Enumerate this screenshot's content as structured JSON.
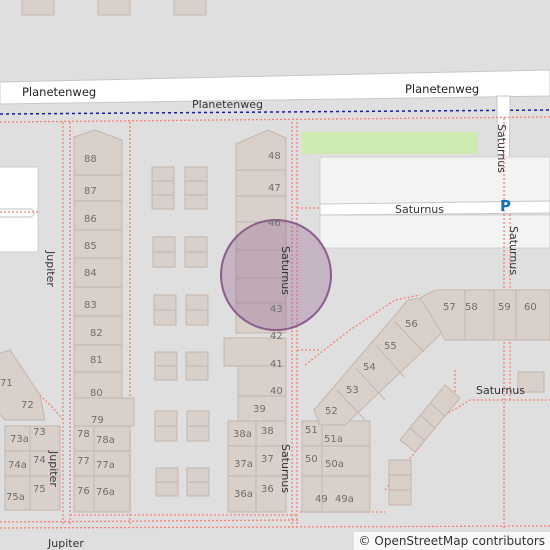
{
  "streets": {
    "planetenweg_left": "Planetenweg",
    "planetenweg_right": "Planetenweg",
    "planetenweg_path": "Planetenweg",
    "saturnus_vert_top": "Saturnus",
    "saturnus_horiz": "Saturnus",
    "saturnus_vert_right": "Saturnus",
    "saturnus_center": "Saturnus",
    "saturnus_bottom": "Saturnus",
    "saturnus_southeast": "Saturnus",
    "jupiter_left": "Jupiter",
    "jupiter_lower": "Jupiter",
    "jupiter_bottom": "Jupiter"
  },
  "parking_symbol": "P",
  "house_numbers": {
    "h88": "88",
    "h87": "87",
    "h86": "86",
    "h85": "85",
    "h84": "84",
    "h83": "83",
    "h82": "82",
    "h81": "81",
    "h80": "80",
    "h79": "79",
    "h78": "78",
    "h78a": "78a",
    "h77": "77",
    "h77a": "77a",
    "h76": "76",
    "h76a": "76a",
    "h73a": "73a",
    "h73": "73",
    "h74a": "74a",
    "h74": "74",
    "h75a": "75a",
    "h75": "75",
    "h72": "72",
    "h71": "71",
    "h48": "48",
    "h47": "47",
    "h46": "46",
    "h43": "43",
    "h42": "42",
    "h41": "41",
    "h40": "40",
    "h39": "39",
    "h38a": "38a",
    "h38": "38",
    "h37a": "37a",
    "h37": "37",
    "h36a": "36a",
    "h36": "36",
    "h51": "51",
    "h51a": "51a",
    "h50": "50",
    "h50a": "50a",
    "h49": "49",
    "h49a": "49a",
    "h52": "52",
    "h53": "53",
    "h54": "54",
    "h55": "55",
    "h56": "56",
    "h57": "57",
    "h58": "58",
    "h59": "59",
    "h60": "60"
  },
  "attribution": {
    "symbol": "©",
    "link": "OpenStreetMap contributors"
  },
  "colors": {
    "background": "#e0dfdf",
    "road": "#ffffff",
    "building": "#d9d0c9",
    "footway": "#fa8072",
    "grass": "#cdebb0",
    "boundary": "#0000cc",
    "marker": "#8c5d8f",
    "parking": "#0a74c4"
  }
}
